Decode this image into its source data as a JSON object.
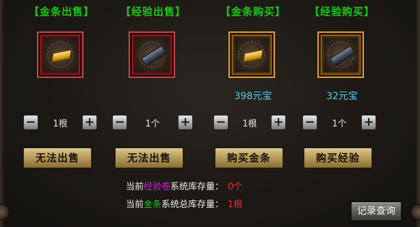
{
  "columns": [
    {
      "title": "【金条出售】",
      "item": "gold-bar",
      "frame": "red",
      "price": "",
      "quantity": "1根",
      "action": "无法出售"
    },
    {
      "title": "【经验出售】",
      "item": "scroll",
      "frame": "red",
      "price": "",
      "quantity": "1个",
      "action": "无法出售"
    },
    {
      "title": "【金条购买】",
      "item": "gold-bar",
      "frame": "gold",
      "price": "398元宝",
      "quantity": "1根",
      "action": "购买金条"
    },
    {
      "title": "【经验购买】",
      "item": "scroll",
      "frame": "gold",
      "price": "32元宝",
      "quantity": "1个",
      "action": "购买经验"
    }
  ],
  "stepper": {
    "minus": "−",
    "plus": "+"
  },
  "stock": {
    "exp": {
      "prefix": "当前",
      "name": "经验卷",
      "suffix": "系统库存量：",
      "value": "0个"
    },
    "gold": {
      "prefix": "当前",
      "name": "金条",
      "suffix": "系统总库存量：",
      "value": "1根"
    }
  },
  "log_button": "记录查询",
  "colors": {
    "title": "#19c619",
    "price": "#4ed0f0",
    "highlight_purple": "#d020e0",
    "highlight_red": "#ff2828"
  }
}
